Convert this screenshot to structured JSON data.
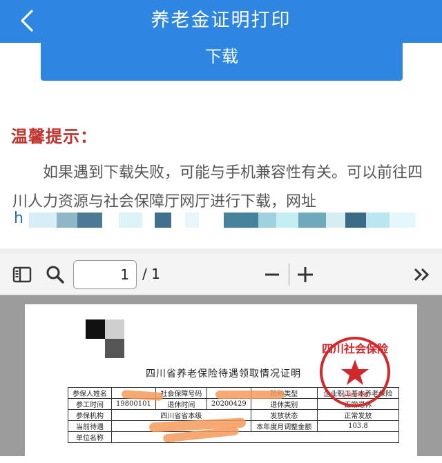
{
  "header": {
    "title": "养老金证明打印",
    "back_icon": "chevron-left-icon"
  },
  "actions": {
    "download_label": "下载"
  },
  "tips": {
    "title": "温馨提示：",
    "body": "如果遇到下载失败，可能与手机兼容性有关。可以前往四川人力资源与社会保障厅网厅进行下载，网址",
    "url_prefix": "h"
  },
  "viewer": {
    "current_page": "1",
    "total_pages": "/ 1",
    "icons": [
      "sidebar-icon",
      "search-icon",
      "zoom-out-icon",
      "zoom-in-icon",
      "more-tools-icon"
    ]
  },
  "document": {
    "heading": "四川省养老保险待遇领取情况证明",
    "rows": [
      [
        "参保人姓名",
        "",
        "社会保障号码",
        "",
        "险种类型",
        "企业职工基本养老保险"
      ],
      [
        "参工时间",
        "19800101",
        "退休时间",
        "20200429",
        "退休类别",
        "正常退休"
      ],
      [
        "参保机构",
        "四川省省本级",
        "",
        "",
        "发放状态",
        "正常发放"
      ],
      [
        "当前待遇",
        "",
        "",
        "",
        "本年度月调整金额",
        "103.8"
      ],
      [
        "单位名称",
        "",
        "",
        "",
        "",
        ""
      ]
    ],
    "seal_text": "四川社会保险",
    "seal_sub": "业务专用章"
  },
  "colors": {
    "primary": "#2f86e0",
    "tip_red": "#c0312b",
    "seal_red": "#d2282c"
  }
}
